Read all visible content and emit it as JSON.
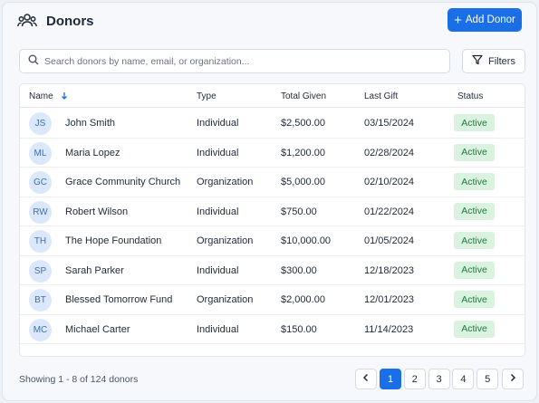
{
  "header": {
    "title": "Donors",
    "add_button_label": "Add Donor"
  },
  "search": {
    "placeholder": "Search donors by name, email, or organization...",
    "value": ""
  },
  "filters": {
    "label": "Filters"
  },
  "table": {
    "columns": {
      "name": "Name",
      "type": "Type",
      "total": "Total Given",
      "last": "Last Gift",
      "status": "Status"
    },
    "rows": [
      {
        "initials": "JS",
        "name": "John Smith",
        "type": "Individual",
        "total": "$2,500.00",
        "last": "03/15/2024",
        "status": "Active"
      },
      {
        "initials": "ML",
        "name": "Maria Lopez",
        "type": "Individual",
        "total": "$1,200.00",
        "last": "02/28/2024",
        "status": "Active"
      },
      {
        "initials": "GC",
        "name": "Grace Community Church",
        "type": "Organization",
        "total": "$5,000.00",
        "last": "02/10/2024",
        "status": "Active"
      },
      {
        "initials": "RW",
        "name": "Robert Wilson",
        "type": "Individual",
        "total": "$750.00",
        "last": "01/22/2024",
        "status": "Active"
      },
      {
        "initials": "TH",
        "name": "The Hope Foundation",
        "type": "Organization",
        "total": "$10,000.00",
        "last": "01/05/2024",
        "status": "Active"
      },
      {
        "initials": "SP",
        "name": "Sarah Parker",
        "type": "Individual",
        "total": "$300.00",
        "last": "12/18/2023",
        "status": "Active"
      },
      {
        "initials": "BT",
        "name": "Blessed Tomorrow Fund",
        "type": "Organization",
        "total": "$2,000.00",
        "last": "12/01/2023",
        "status": "Active"
      },
      {
        "initials": "MC",
        "name": "Michael Carter",
        "type": "Individual",
        "total": "$150.00",
        "last": "11/14/2023",
        "status": "Active"
      }
    ]
  },
  "footer": {
    "showing": "Showing 1 - 8 of 124 donors",
    "pages": [
      "1",
      "2",
      "3",
      "4",
      "5"
    ],
    "current_page": "1"
  },
  "colors": {
    "accent": "#1a6fe6",
    "active_bg": "#d9f3e0",
    "active_text": "#1e7a3c",
    "avatar_bg": "#dbe8fb"
  },
  "icons": {
    "title": "people-group-icon",
    "add": "plus-icon",
    "search": "search-icon",
    "filters": "filter-icon",
    "sort": "sort-arrow-icon",
    "prev": "chevron-left-icon",
    "next": "chevron-right-icon"
  }
}
